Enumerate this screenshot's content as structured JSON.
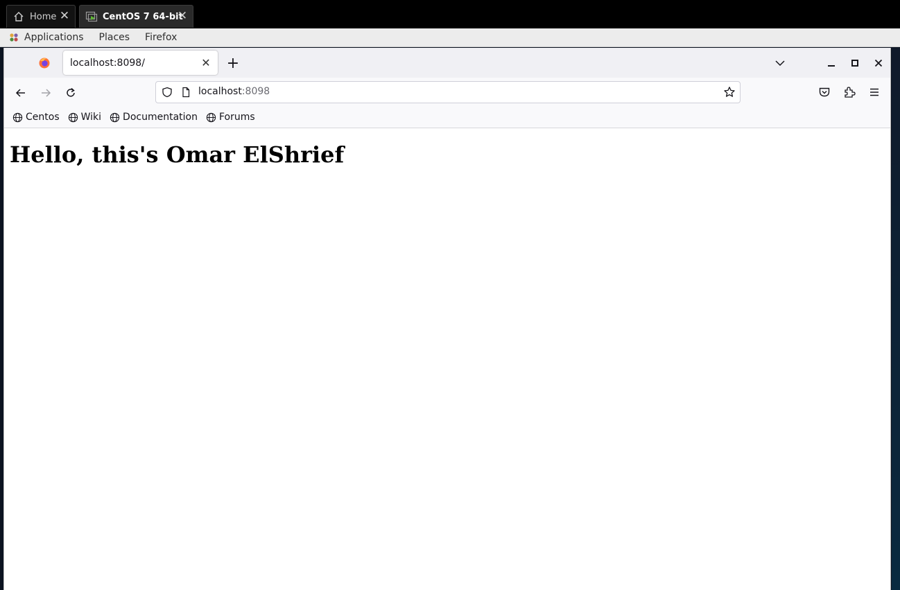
{
  "vm_tabs": [
    {
      "label": "Home",
      "icon": "home-icon",
      "active": false
    },
    {
      "label": "CentOS 7 64-bit",
      "icon": "vm-console-icon",
      "active": true
    }
  ],
  "gnome_panel": {
    "menus": [
      "Applications",
      "Places",
      "Firefox"
    ]
  },
  "browser": {
    "tab": {
      "title": "localhost:8098/"
    },
    "url": {
      "host": "localhost",
      "port": ":8098"
    },
    "bookmarks": [
      "Centos",
      "Wiki",
      "Documentation",
      "Forums"
    ]
  },
  "page": {
    "heading": "Hello, this's Omar ElShrief"
  },
  "colors": {
    "vm_bar": "#000000",
    "panel": "#ececec",
    "firefox_tabbar": "#f0f0f4",
    "firefox_toolbar": "#f9f9fb"
  }
}
